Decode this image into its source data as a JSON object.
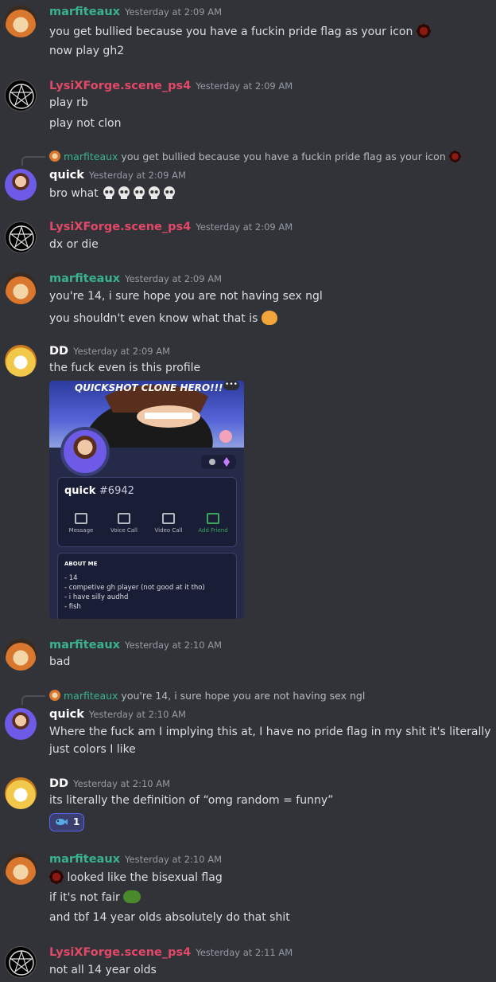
{
  "colors": {
    "background": "#313338",
    "marfiteaux": "#3bb28f",
    "lysix": "#e24868",
    "text": "#dbdee1",
    "timestamp": "#949ba4"
  },
  "messages": [
    {
      "author": "marfiteaux",
      "time": "Yesterday at 2:09 AM",
      "lines": [
        "you get bullied because you have a fuckin pride flag as your icon",
        "now play gh2"
      ]
    },
    {
      "author": "LysiXForge.scene_ps4",
      "time": "Yesterday at 2:09 AM",
      "lines": [
        "play rb",
        "play not clon"
      ]
    },
    {
      "reply": {
        "author": "marfiteaux",
        "text": "you get bullied because you have a fuckin pride flag as your icon"
      },
      "author": "quick",
      "time": "Yesterday at 2:09 AM",
      "lines": [
        "bro what"
      ]
    },
    {
      "author": "LysiXForge.scene_ps4",
      "time": "Yesterday at 2:09 AM",
      "lines": [
        "dx or die"
      ]
    },
    {
      "author": "marfiteaux",
      "time": "Yesterday at 2:09 AM",
      "lines": [
        "you're 14, i sure hope you are not having sex ngl",
        "you shouldn't even know what that is"
      ]
    },
    {
      "author": "DD",
      "time": "Yesterday at 2:09 AM",
      "lines": [
        "the fuck even is this profile"
      ],
      "embed": {
        "banner_title": "QUICKSHOT CLONE HERO!!!",
        "dots": "•••",
        "username": "quick",
        "tag": "#6942",
        "buttons": [
          "Message",
          "Voice Call",
          "Video Call",
          "Add Friend"
        ],
        "about_heading": "ABOUT ME",
        "about_lines": [
          "- 14",
          "- competive gh player (not good at it tho)",
          "- i have silly audhd",
          "- fish"
        ]
      }
    },
    {
      "author": "marfiteaux",
      "time": "Yesterday at 2:10 AM",
      "lines": [
        "bad"
      ]
    },
    {
      "reply": {
        "author": "marfiteaux",
        "text": "you're 14, i sure hope you are not having sex ngl"
      },
      "author": "quick",
      "time": "Yesterday at 2:10 AM",
      "lines": [
        "Where the fuck am I implying this at, I have no pride flag in my shit it's literally just colors I like"
      ]
    },
    {
      "author": "DD",
      "time": "Yesterday at 2:10 AM",
      "lines": [
        "its literally the definition of “omg random = funny”"
      ],
      "reaction": {
        "emoji": "fish-emoji",
        "count": "1"
      }
    },
    {
      "author": "marfiteaux",
      "time": "Yesterday at 2:10 AM",
      "lines": [
        "looked like the bisexual flag",
        "if it's not fair",
        "and tbf 14 year olds absolutely do that shit"
      ]
    },
    {
      "author": "LysiXForge.scene_ps4",
      "time": "Yesterday at 2:11 AM",
      "lines": [
        "not all 14 year olds"
      ]
    }
  ]
}
